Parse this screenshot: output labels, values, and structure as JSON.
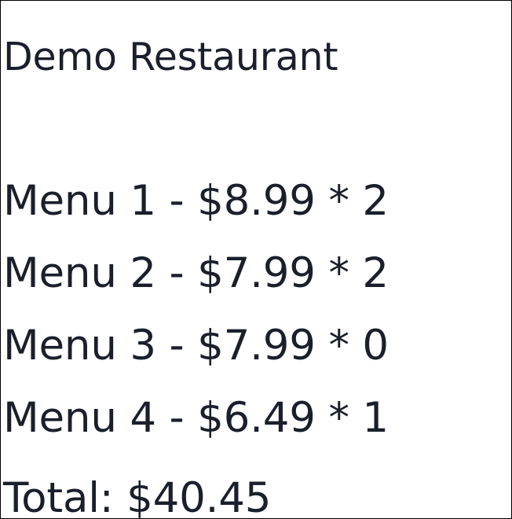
{
  "restaurant": {
    "name": "Demo Restaurant"
  },
  "menu": {
    "items": [
      {
        "label": "Menu 1 - $8.99 * 2"
      },
      {
        "label": "Menu 2 - $7.99 * 2"
      },
      {
        "label": "Menu 3 - $7.99 * 0"
      },
      {
        "label": "Menu 4 - $6.49 * 1"
      }
    ]
  },
  "order": {
    "total_label": "Total: $40.45"
  }
}
